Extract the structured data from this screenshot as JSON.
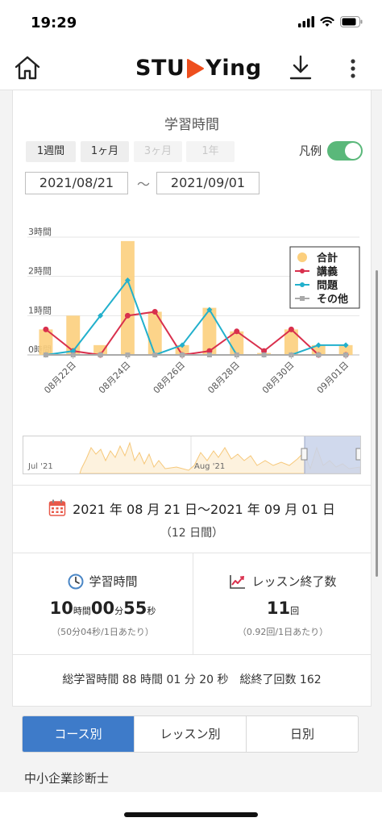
{
  "status_bar": {
    "time": "19:29"
  },
  "header": {
    "logo_left": "STU",
    "logo_right": "Ying"
  },
  "chart_card": {
    "title": "学習時間",
    "periods": [
      {
        "label": "1週間",
        "enabled": true
      },
      {
        "label": "1ヶ月",
        "enabled": true
      },
      {
        "label": "3ヶ月",
        "enabled": false
      },
      {
        "label": "1年",
        "enabled": false
      }
    ],
    "legend_toggle_label": "凡例",
    "legend_toggle_on": true,
    "date_from": "2021/08/21",
    "date_to": "2021/09/01",
    "tilde": "〜",
    "navigator_labels": [
      "Jul '21",
      "Aug '21"
    ]
  },
  "chart_data": {
    "type": "bar",
    "y_ticks": [
      "0時間",
      "1時間",
      "2時間",
      "3時間"
    ],
    "ylim": [
      0,
      3
    ],
    "x_tick_labels": [
      "08月22日",
      "08月24日",
      "08月26日",
      "08月28日",
      "08月30日",
      "09月01日"
    ],
    "categories": [
      "08/21",
      "08/22",
      "08/23",
      "08/24",
      "08/25",
      "08/26",
      "08/27",
      "08/28",
      "08/29",
      "08/30",
      "08/31",
      "09/01"
    ],
    "grid": true,
    "legend_position": "top-right",
    "series": [
      {
        "name": "合計",
        "type": "bar",
        "color": "#fccf7d",
        "values": [
          0.65,
          1.0,
          0.25,
          2.9,
          1.1,
          0.25,
          1.2,
          0.6,
          0.05,
          0.65,
          0.25,
          0.25
        ]
      },
      {
        "name": "講義",
        "type": "line",
        "color": "#d9304d",
        "values": [
          0.65,
          0.1,
          0.0,
          1.0,
          1.1,
          0.0,
          0.1,
          0.6,
          0.1,
          0.65,
          0.0,
          0.0
        ]
      },
      {
        "name": "問題",
        "type": "line",
        "color": "#22b0cc",
        "values": [
          0.0,
          0.1,
          1.0,
          1.9,
          0.0,
          0.25,
          1.15,
          0.0,
          0.0,
          0.0,
          0.25,
          0.25
        ]
      },
      {
        "name": "その他",
        "type": "line",
        "color": "#aaaaaa",
        "values": [
          0,
          0,
          0,
          0,
          0,
          0,
          0,
          0,
          0,
          0,
          0,
          0
        ]
      }
    ]
  },
  "date_range": {
    "text": "2021 年 08 月 21 日〜2021 年 09 月 01 日",
    "days": "（12 日間）"
  },
  "stats": {
    "study_time": {
      "label": "学習時間",
      "hours": "10",
      "hours_unit": "時間",
      "minutes": "00",
      "minutes_unit": "分",
      "seconds": "55",
      "seconds_unit": "秒",
      "sub": "（50分04秒/1日あたり）"
    },
    "lessons": {
      "label": "レッスン終了数",
      "count": "11",
      "count_unit": "回",
      "sub": "（0.92回/1日あたり）"
    }
  },
  "totals": {
    "text": "総学習時間 88 時間 01 分 20 秒　総終了回数 162"
  },
  "tabs": [
    {
      "label": "コース別",
      "active": true
    },
    {
      "label": "レッスン別",
      "active": false
    },
    {
      "label": "日別",
      "active": false
    }
  ],
  "course": {
    "name": "中小企業診断士"
  }
}
